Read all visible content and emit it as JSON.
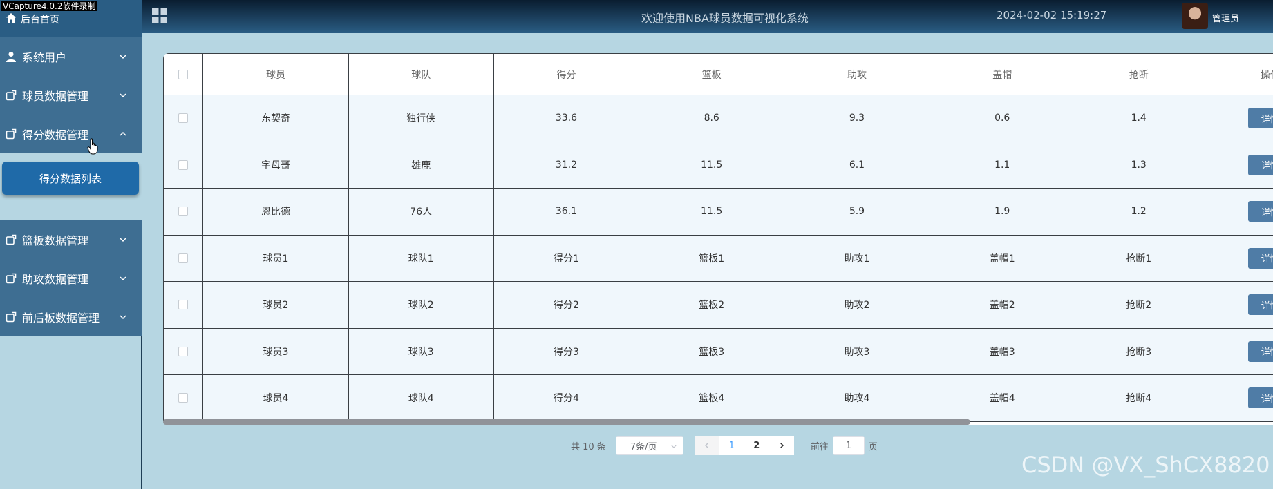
{
  "recorder_watermark": "VCapture4.0.2软件录制",
  "sidebar": {
    "home_label": "后台首页",
    "items": [
      {
        "label": "系统用户"
      },
      {
        "label": "球员数据管理"
      },
      {
        "label": "得分数据管理"
      },
      {
        "label": "篮板数据管理"
      },
      {
        "label": "助攻数据管理"
      },
      {
        "label": "前后板数据管理"
      }
    ],
    "active_sub_label": "得分数据列表"
  },
  "header": {
    "title": "欢迎使用NBA球员数据可视化系统",
    "datetime": "2024-02-02 15:19:27",
    "user": "管理员"
  },
  "table": {
    "columns": [
      "球员",
      "球队",
      "得分",
      "篮板",
      "助攻",
      "盖帽",
      "抢断",
      "操作"
    ],
    "rows": [
      [
        "东契奇",
        "独行侠",
        "33.6",
        "8.6",
        "9.3",
        "0.6",
        "1.4"
      ],
      [
        "字母哥",
        "雄鹿",
        "31.2",
        "11.5",
        "6.1",
        "1.1",
        "1.3"
      ],
      [
        "恩比德",
        "76人",
        "36.1",
        "11.5",
        "5.9",
        "1.9",
        "1.2"
      ],
      [
        "球员1",
        "球队1",
        "得分1",
        "篮板1",
        "助攻1",
        "盖帽1",
        "抢断1"
      ],
      [
        "球员2",
        "球队2",
        "得分2",
        "篮板2",
        "助攻2",
        "盖帽2",
        "抢断2"
      ],
      [
        "球员3",
        "球队3",
        "得分3",
        "篮板3",
        "助攻3",
        "盖帽3",
        "抢断3"
      ],
      [
        "球员4",
        "球队4",
        "得分4",
        "篮板4",
        "助攻4",
        "盖帽4",
        "抢断4"
      ]
    ],
    "action_label": "详情"
  },
  "pagination": {
    "total": "共 10 条",
    "page_size": "7条/页",
    "pages": [
      "1",
      "2"
    ],
    "goto_prefix": "前往",
    "goto_value": "1",
    "goto_suffix": "页"
  },
  "csdn_watermark": "CSDN @VX_ShCX8820",
  "colors": {
    "sidebar_item": "#3e6e92",
    "active_sub": "#1f6aa8",
    "detail_button": "#4f7ca6",
    "background": "#b6d6e2"
  }
}
